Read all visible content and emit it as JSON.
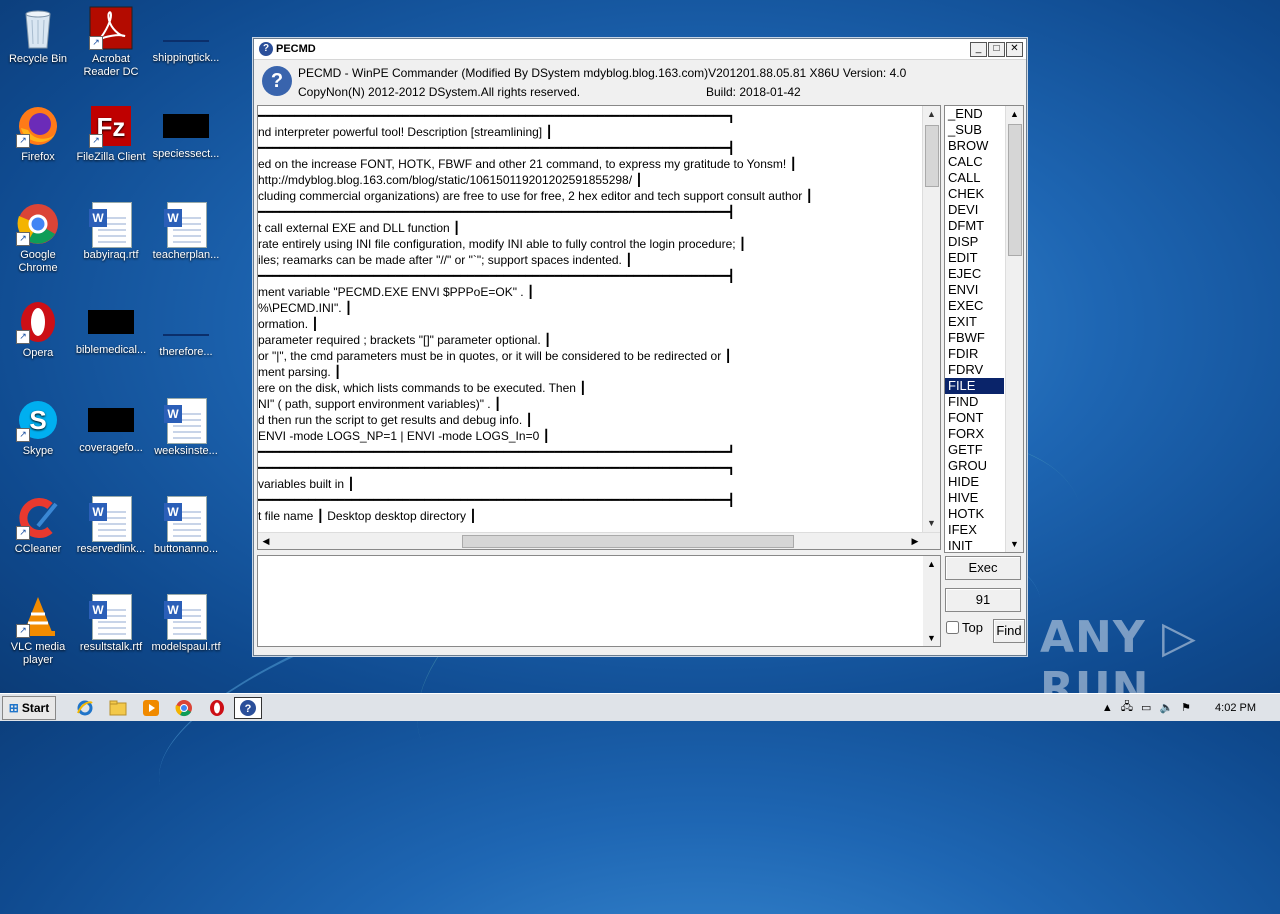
{
  "desktop": {
    "icons": [
      {
        "label": "Recycle Bin"
      },
      {
        "label": "Acrobat Reader DC"
      },
      {
        "label": "shippingtick..."
      },
      {
        "label": "Firefox"
      },
      {
        "label": "FileZilla Client"
      },
      {
        "label": "speciessect..."
      },
      {
        "label": "Google Chrome"
      },
      {
        "label": "babyiraq.rtf"
      },
      {
        "label": "teacherplan..."
      },
      {
        "label": "Opera"
      },
      {
        "label": "biblemedical..."
      },
      {
        "label": "therefore..."
      },
      {
        "label": "Skype"
      },
      {
        "label": "coveragefo..."
      },
      {
        "label": "weeksinste..."
      },
      {
        "label": "CCleaner"
      },
      {
        "label": "reservedlink..."
      },
      {
        "label": "buttonanno..."
      },
      {
        "label": "VLC media player"
      },
      {
        "label": "resultstalk.rtf"
      },
      {
        "label": "modelspaul.rtf"
      }
    ]
  },
  "window": {
    "title": "PECMD",
    "header_line1": "PECMD - WinPE Commander (Modified By DSystem mdyblog.blog.163.com)V201201.88.05.81 X86U  Version: 4.0",
    "header_line2": "CopyNon(N) 2012-2012 DSystem.All rights reserved.",
    "build": "Build: 2018-01-42",
    "lines": [
      "━━━━━━━━━━━━━━━━━━━━━━━━━━━━━━━━━━━━━━━━━━━━━━━━━━━━━━━━━━━━━━━━━┓",
      "nd interpreter powerful tool! Description [streamlining]  ┃",
      "━━━━━━━━━━━━━━━━━━━━━━━━━━━━━━━━━━━━━━━━━━━━━━━━━━━━━━━━━━━━━━━━━┫",
      "ed on the increase FONT, HOTK, FBWF and other 21 command, to express my gratitude to Yonsm!  ┃",
      "http://mdyblog.blog.163.com/blog/static/10615011920120259185529​8/  ┃",
      "cluding commercial organizations) are free to use for free, 2 hex editor and tech support consult author  ┃",
      "━━━━━━━━━━━━━━━━━━━━━━━━━━━━━━━━━━━━━━━━━━━━━━━━━━━━━━━━━━━━━━━━━┫",
      "t call external EXE and DLL function  ┃",
      "rate entirely using INI file configuration, modify INI able to fully control the login procedure;  ┃",
      "iles; reamarks can be made after \"//\" or \"`\"; support spaces indented.  ┃",
      "━━━━━━━━━━━━━━━━━━━━━━━━━━━━━━━━━━━━━━━━━━━━━━━━━━━━━━━━━━━━━━━━━┫",
      "ment variable  \"PECMD.EXE ENVI $PPPoE=OK\" .  ┃",
      "%\\PECMD.INI\".  ┃",
      "ormation.  ┃",
      " parameter required ; brackets \"[]\" parameter optional.  ┃",
      " or \"|\", the  cmd parameters  must be in quotes, or it will be considered to be redirected or  ┃",
      "ment parsing.  ┃",
      "ere on the disk, which lists commands to be executed. Then  ┃",
      "NI\" ( path, support environment variables)\" .  ┃",
      "d then run the script to get results and debug info.  ┃",
      "ENVI -mode LOGS_NP=1 | ENVI -mode LOGS_In=0  ┃",
      "━━━━━━━━━━━━━━━━━━━━━━━━━━━━━━━━━━━━━━━━━━━━━━━━━━━━━━━━━━━━━━━━━┛",
      "━━━━━━━━━━━━━━━━━━━━━━━━━━━━━━━━━━━━━━━━━━━━━━━━━━━━━━━━━━━━━━━━━┓",
      "variables built in ┃",
      "━━━━━━━━━━━━━━━━━━━━━━━━━━━━━━━━━━━━━━━━━━━━━━━━━━━━━━━━━━━━━━━━━┫",
      "t file name  ┃  Desktop desktop directory ┃"
    ],
    "commands": [
      "_END",
      "_SUB",
      "BROW",
      "CALC",
      "CALL",
      "CHEK",
      "DEVI",
      "DFMT",
      "DISP",
      "EDIT",
      "EJEC",
      "ENVI",
      "EXEC",
      "EXIT",
      "FBWF",
      "FDIR",
      "FDRV",
      "FILE",
      "FIND",
      "FONT",
      "FORX",
      "GETF",
      "GROU",
      "HIDE",
      "HIVE",
      "HOTK",
      "IFEX",
      "INIT"
    ],
    "selected_command": "FILE",
    "exec_label": "Exec",
    "count_label": "91",
    "top_label": "Top",
    "find_label": "Find"
  },
  "watermark": "ANY ▷ RUN",
  "taskbar": {
    "start_label": "Start",
    "clock": "4:02 PM"
  }
}
